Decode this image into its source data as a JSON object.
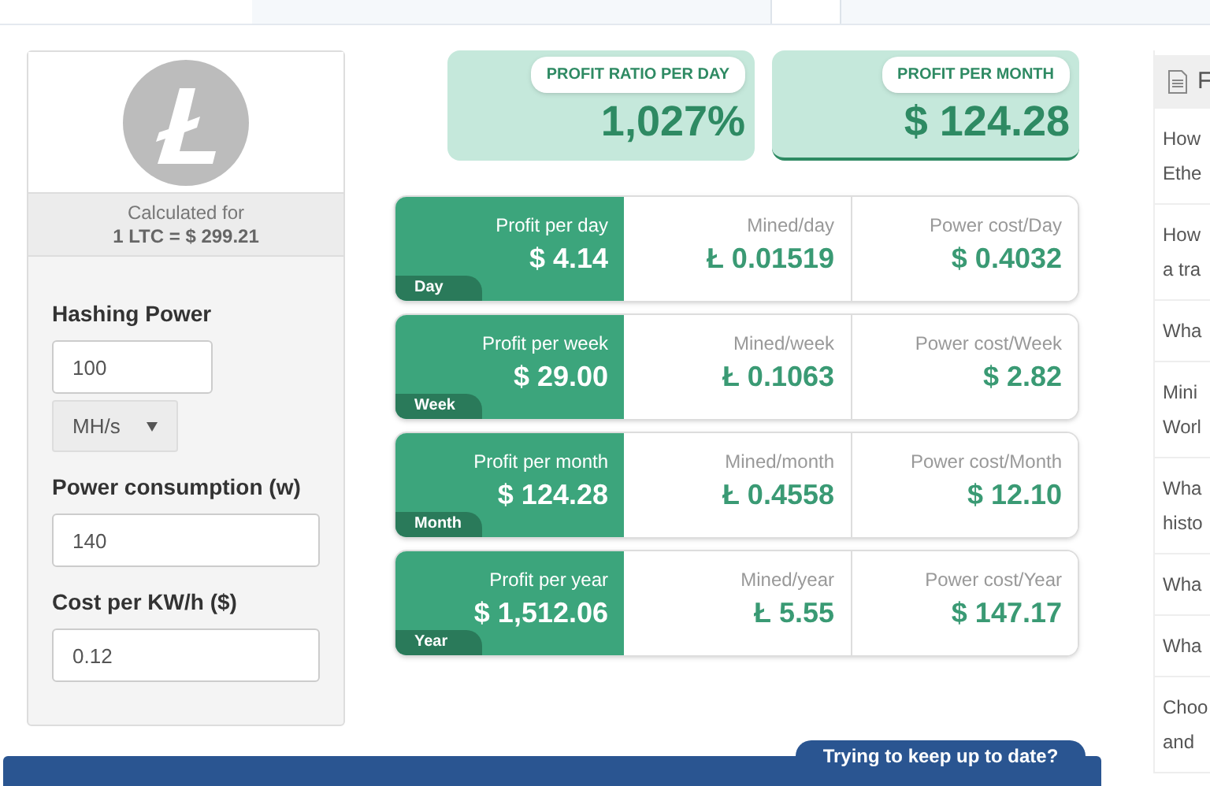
{
  "coin": {
    "calculated_label": "Calculated for",
    "rate": "1 LTC = $ 299.21"
  },
  "form": {
    "fields": [
      {
        "kind": "input",
        "label": "Hashing Power",
        "value": "100"
      },
      {
        "kind": "select",
        "value": "MH/s"
      },
      {
        "kind": "input",
        "label": "Power consumption (w)",
        "value": "140"
      },
      {
        "kind": "input",
        "label": "Cost per KW/h ($)",
        "value": "0.12"
      }
    ]
  },
  "summary": [
    {
      "label": "PROFIT RATIO PER DAY",
      "value": "1,027%"
    },
    {
      "label": "PROFIT PER MONTH",
      "value": "$ 124.28"
    }
  ],
  "periods": [
    {
      "tag": "Day",
      "profit_label": "Profit per day",
      "profit": "$ 4.14",
      "mined_label": "Mined/day",
      "mined": "Ł 0.01519",
      "cost_label": "Power cost/Day",
      "cost": "$ 0.4032"
    },
    {
      "tag": "Week",
      "profit_label": "Profit per week",
      "profit": "$ 29.00",
      "mined_label": "Mined/week",
      "mined": "Ł 0.1063",
      "cost_label": "Power cost/Week",
      "cost": "$ 2.82"
    },
    {
      "tag": "Month",
      "profit_label": "Profit per month",
      "profit": "$ 124.28",
      "mined_label": "Mined/month",
      "mined": "Ł 0.4558",
      "cost_label": "Power cost/Month",
      "cost": "$ 12.10"
    },
    {
      "tag": "Year",
      "profit_label": "Profit per year",
      "profit": "$ 1,512.06",
      "mined_label": "Mined/year",
      "mined": "Ł 5.55",
      "cost_label": "Power cost/Year",
      "cost": "$ 147.17"
    }
  ],
  "sidebar": {
    "title": "F",
    "items": [
      [
        "How",
        "Ethe"
      ],
      [
        "How",
        "a tra"
      ],
      [
        "Wha"
      ],
      [
        "Mini",
        "Worl"
      ],
      [
        "Wha",
        "histo"
      ],
      [
        "Wha"
      ],
      [
        "Wha"
      ],
      [
        "Choo",
        "and"
      ]
    ]
  },
  "banner": {
    "tab": "Trying to keep up to date?"
  }
}
